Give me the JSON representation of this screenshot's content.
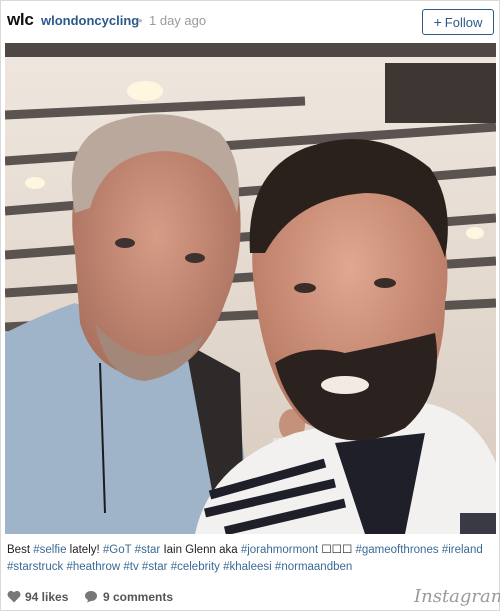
{
  "header": {
    "avatar_text": "wlc",
    "username": "wlondoncycling",
    "separator": "•",
    "time": "1 day ago",
    "follow_label": "Follow"
  },
  "photo": {
    "description_icon": "selfie-photo"
  },
  "caption": {
    "parts": [
      {
        "text": "Best ",
        "tag": false
      },
      {
        "text": "#selfie",
        "tag": true
      },
      {
        "text": " lately! ",
        "tag": false
      },
      {
        "text": "#GoT",
        "tag": true
      },
      {
        "text": " ",
        "tag": false
      },
      {
        "text": "#star",
        "tag": true
      },
      {
        "text": " Iain Glenn aka ",
        "tag": false
      },
      {
        "text": "#jorahmormont",
        "tag": true
      },
      {
        "text": " ☐☐☐ ",
        "tag": false
      },
      {
        "text": "#gameofthrones",
        "tag": true
      },
      {
        "text": " ",
        "tag": false
      },
      {
        "text": "#ireland",
        "tag": true
      },
      {
        "text": " ",
        "tag": false
      },
      {
        "text": "#starstruck",
        "tag": true
      },
      {
        "text": " ",
        "tag": false
      },
      {
        "text": "#heathrow",
        "tag": true
      },
      {
        "text": " ",
        "tag": false
      },
      {
        "text": "#tv",
        "tag": true
      },
      {
        "text": " ",
        "tag": false
      },
      {
        "text": "#star",
        "tag": true
      },
      {
        "text": " ",
        "tag": false
      },
      {
        "text": "#celebrity",
        "tag": true
      },
      {
        "text": " ",
        "tag": false
      },
      {
        "text": "#khaleesi",
        "tag": true
      },
      {
        "text": " ",
        "tag": false
      },
      {
        "text": "#normaandben",
        "tag": true
      }
    ]
  },
  "footer": {
    "likes": "94 likes",
    "comments": "9 comments",
    "brand": "Instagram"
  },
  "colors": {
    "link": "#2b5a8a",
    "hashtag": "#3b6a96",
    "muted": "#9a9a9a"
  }
}
